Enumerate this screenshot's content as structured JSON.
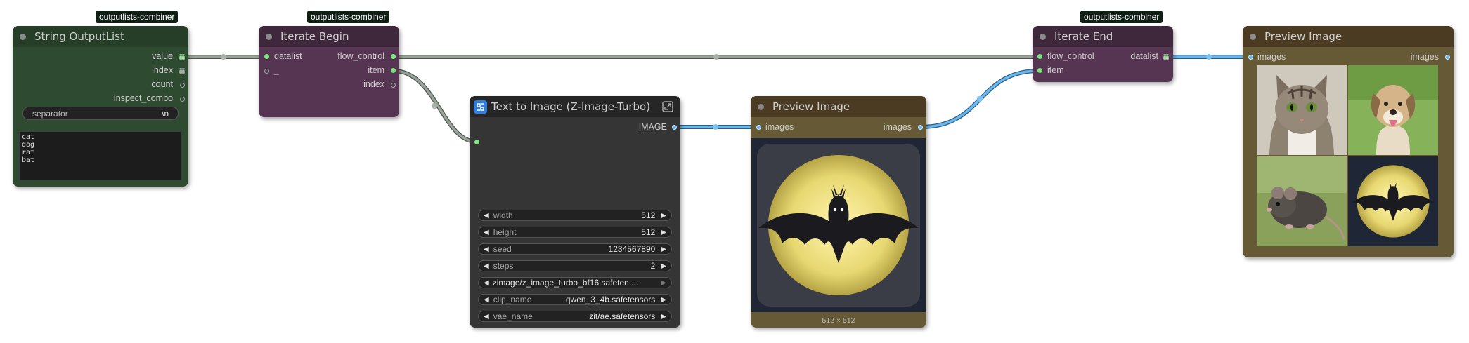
{
  "badges": [
    "outputlists-combiner",
    "outputlists-combiner",
    "outputlists-combiner"
  ],
  "string_outputlist": {
    "title": "String OutputList",
    "outputs": [
      "value",
      "index",
      "count",
      "inspect_combo"
    ],
    "separator_label": "separator",
    "separator_value": "\\n",
    "text_value": "cat\ndog\nrat\nbat"
  },
  "iterate_begin": {
    "title": "Iterate Begin",
    "inputs": [
      "datalist",
      "_"
    ],
    "outputs": [
      "flow_control",
      "item",
      "index"
    ]
  },
  "text_to_image": {
    "title": "Text to Image (Z-Image-Turbo)",
    "output": "IMAGE",
    "widgets": [
      {
        "label": "width",
        "value": "512"
      },
      {
        "label": "height",
        "value": "512"
      },
      {
        "label": "seed",
        "value": "1234567890"
      },
      {
        "label": "steps",
        "value": "2"
      },
      {
        "label": "",
        "value": "zimage/z_image_turbo_bf16.safeten ..."
      },
      {
        "label": "clip_name",
        "value": "qwen_3_4b.safetensors"
      },
      {
        "label": "vae_name",
        "value": "zit/ae.safetensors"
      }
    ]
  },
  "preview_mid": {
    "title": "Preview Image",
    "input": "images",
    "output": "images",
    "caption": "512 × 512"
  },
  "iterate_end": {
    "title": "Iterate End",
    "inputs": [
      "flow_control",
      "item"
    ],
    "output": "datalist"
  },
  "preview_right": {
    "title": "Preview Image",
    "input": "images",
    "output": "images"
  },
  "colors": {
    "green_node": "#2e4a30",
    "green_header": "#263d28",
    "purple_node": "#553551",
    "purple_header": "#3f283c",
    "dark_node": "#353535",
    "dark_header": "#262626",
    "brown_node": "#665a36",
    "brown_header": "#4a3b22",
    "wire_grey": "#8c968e",
    "wire_blue": "#68b8ef"
  }
}
